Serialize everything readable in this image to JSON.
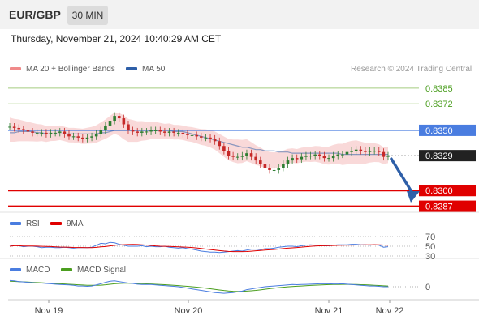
{
  "header": {
    "symbol": "EUR/GBP",
    "timeframe": "30 MIN"
  },
  "datetime": "Thursday, November 21, 2024 10:40:29 AM CET",
  "legend": {
    "bollinger": "MA 20 + Bollinger Bands",
    "ma50": "MA 50",
    "credit": "Research © 2024 Trading Central",
    "rsi": "RSI",
    "rsi_ma": "9MA",
    "macd": "MACD",
    "macd_signal": "MACD Signal"
  },
  "levels": [
    {
      "value": "0.8385",
      "kind": "resistance-green"
    },
    {
      "value": "0.8372",
      "kind": "resistance-green"
    },
    {
      "value": "0.8350",
      "kind": "pivot-blue"
    },
    {
      "value": "0.8329",
      "kind": "last-price"
    },
    {
      "value": "0.8300",
      "kind": "target-red"
    },
    {
      "value": "0.8287",
      "kind": "target-red"
    }
  ],
  "rsi_levels": [
    "70",
    "50",
    "30"
  ],
  "macd_zero": "0",
  "x_axis": [
    "Nov 19",
    "Nov 20",
    "Nov 21",
    "Nov 22"
  ],
  "colors": {
    "green": "#4b9e1f",
    "blue": "#4a7de0",
    "red": "#e00000",
    "up": "#2e7d32",
    "down": "#c62828",
    "band": "#f7c9c9",
    "ma50": "#2e5fa8",
    "arrow": "#2e5fa8",
    "dark": "#222222"
  },
  "chart_data": {
    "type": "line",
    "title": "EUR/GBP",
    "price_ylim": [
      0.8282,
      0.8393
    ],
    "close": [
      0.8353,
      0.8352,
      0.8351,
      0.835,
      0.8349,
      0.8348,
      0.8348,
      0.8348,
      0.8347,
      0.8348,
      0.8348,
      0.8349,
      0.8347,
      0.8345,
      0.8345,
      0.8344,
      0.8343,
      0.8344,
      0.8345,
      0.8347,
      0.835,
      0.8354,
      0.8358,
      0.8362,
      0.836,
      0.8355,
      0.835,
      0.8349,
      0.8348,
      0.8349,
      0.8349,
      0.835,
      0.835,
      0.8349,
      0.8348,
      0.8349,
      0.8348,
      0.8348,
      0.8347,
      0.8346,
      0.8346,
      0.8345,
      0.8344,
      0.8344,
      0.8343,
      0.8341,
      0.8337,
      0.8333,
      0.8329,
      0.8328,
      0.8328,
      0.8329,
      0.8331,
      0.8328,
      0.8325,
      0.8322,
      0.8319,
      0.8317,
      0.8317,
      0.8319,
      0.8322,
      0.8325,
      0.8327,
      0.8326,
      0.8328,
      0.8329,
      0.8329,
      0.833,
      0.8329,
      0.8327,
      0.8327,
      0.8329,
      0.833,
      0.833,
      0.8332,
      0.8333,
      0.8334,
      0.8333,
      0.8332,
      0.8333,
      0.8333,
      0.8332,
      0.8328,
      0.8329
    ],
    "ma50": [
      0.8348,
      0.8348,
      0.8349,
      0.8349,
      0.8349,
      0.8349,
      0.8348,
      0.8348,
      0.8347,
      0.8347,
      0.8347,
      0.8347,
      0.8347,
      0.8347,
      0.8347,
      0.8347,
      0.8347,
      0.8347,
      0.8347,
      0.8347,
      0.8348,
      0.8348,
      0.8349,
      0.835,
      0.835,
      0.835,
      0.835,
      0.835,
      0.835,
      0.835,
      0.835,
      0.835,
      0.835,
      0.835,
      0.835,
      0.835,
      0.8349,
      0.8349,
      0.8349,
      0.8348,
      0.8347,
      0.8346,
      0.8345,
      0.8344,
      0.8343,
      0.8342,
      0.8341,
      0.834,
      0.8339,
      0.8338,
      0.8337,
      0.8336,
      0.8336,
      0.8335,
      0.8334,
      0.8334,
      0.8333,
      0.8333,
      0.8333,
      0.8332,
      0.8332,
      0.8332,
      0.8331,
      0.8331,
      0.8331,
      0.8331,
      0.8331,
      0.8331,
      0.8331,
      0.8331,
      0.8331,
      0.8331,
      0.8331,
      0.833,
      0.833,
      0.833,
      0.833,
      0.833,
      0.833,
      0.833,
      0.833,
      0.833,
      0.833,
      0.833
    ],
    "rsi": [
      50,
      52,
      51,
      49,
      50,
      50,
      49,
      47,
      48,
      48,
      47,
      47,
      48,
      47,
      46,
      47,
      47,
      47,
      48,
      52,
      56,
      55,
      58,
      57,
      54,
      52,
      50,
      50,
      50,
      51,
      49,
      50,
      49,
      49,
      50,
      48,
      47,
      46,
      47,
      45,
      44,
      42,
      40,
      39,
      38,
      38,
      37,
      38,
      39,
      40,
      41,
      40,
      42,
      44,
      44,
      43,
      45,
      45,
      46,
      48,
      49,
      50,
      50,
      49,
      51,
      52,
      53,
      52,
      52,
      51,
      51,
      52,
      53,
      53,
      53,
      54,
      54,
      53,
      53,
      52,
      53,
      52,
      48,
      49
    ],
    "macd": [
      0.00085,
      0.0008,
      0.0007,
      0.00065,
      0.0006,
      0.00055,
      0.0005,
      0.0005,
      0.00045,
      0.0004,
      0.00035,
      0.0003,
      0.00028,
      0.00025,
      0.0002,
      0.0001,
      0.0001,
      5e-05,
      0.0001,
      0.00025,
      0.0004,
      0.0006,
      0.00075,
      0.0008,
      0.0007,
      0.0006,
      0.0005,
      0.00045,
      0.00035,
      0.0003,
      0.0003,
      0.0003,
      0.00025,
      0.0002,
      0.00015,
      0.0001,
      5e-05,
      0.0,
      -0.0001,
      -0.0002,
      -0.0003,
      -0.0004,
      -0.0005,
      -0.0006,
      -0.0007,
      -0.0008,
      -0.00085,
      -0.0009,
      -0.00085,
      -0.0008,
      -0.0007,
      -0.0006,
      -0.0004,
      -0.0003,
      -0.0002,
      -0.0001,
      0.0,
      5e-05,
      0.0001,
      0.00015,
      0.0002,
      0.00025,
      0.0003,
      0.00028,
      0.0003,
      0.00032,
      0.00035,
      0.00038,
      0.0004,
      0.00042,
      0.0004,
      0.00038,
      0.00038,
      0.0004,
      0.00035,
      0.0003,
      0.00025,
      0.0002,
      0.00015,
      0.0001,
      0.0001,
      5e-05,
      0.0,
      0.0
    ],
    "macd_signal": [
      0.00075,
      0.00072,
      0.0007,
      0.00067,
      0.00064,
      0.0006,
      0.00057,
      0.00054,
      0.0005,
      0.00047,
      0.00044,
      0.0004,
      0.00037,
      0.00034,
      0.0003,
      0.00027,
      0.00024,
      0.0002,
      0.00019,
      0.00019,
      0.00021,
      0.00026,
      0.00033,
      0.0004,
      0.00045,
      0.00047,
      0.00047,
      0.00046,
      0.00044,
      0.00041,
      0.00039,
      0.00037,
      0.00034,
      0.00031,
      0.00028,
      0.00024,
      0.0002,
      0.00015,
      0.0001,
      5e-05,
      0.0,
      -6e-05,
      -0.00013,
      -0.0002,
      -0.00028,
      -0.00036,
      -0.00044,
      -0.00052,
      -0.00058,
      -0.00062,
      -0.00064,
      -0.00063,
      -0.0006,
      -0.00055,
      -0.0005,
      -0.00043,
      -0.00035,
      -0.00027,
      -0.0002,
      -0.00013,
      -7e-05,
      -2e-05,
      3e-05,
      7e-05,
      0.0001,
      0.00014,
      0.00018,
      0.00021,
      0.00024,
      0.00027,
      0.00029,
      0.0003,
      0.00031,
      0.00032,
      0.00032,
      0.00031,
      0.0003,
      0.00028,
      0.00026,
      0.00023,
      0.0002,
      0.00017,
      0.00013,
      0.0001
    ]
  }
}
